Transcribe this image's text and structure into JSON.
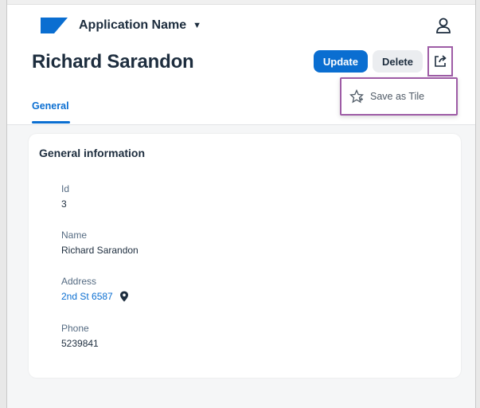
{
  "shell": {
    "app_name": "Application Name"
  },
  "header": {
    "title": "Richard Sarandon",
    "update_label": "Update",
    "delete_label": "Delete",
    "tabs": [
      {
        "label": "General"
      }
    ]
  },
  "share_menu": {
    "items": [
      {
        "label": "Save as Tile",
        "icon": "star-add-icon"
      }
    ]
  },
  "card": {
    "title": "General information",
    "fields": [
      {
        "label": "Id",
        "value": "3"
      },
      {
        "label": "Name",
        "value": "Richard Sarandon"
      },
      {
        "label": "Address",
        "value": "2nd St 6587",
        "icon": "map-pin-icon"
      },
      {
        "label": "Phone",
        "value": "5239841"
      }
    ]
  },
  "colors": {
    "accent": "#0a6ed1",
    "highlight_border": "#9e5ca6",
    "logo": "#0a6ed1"
  }
}
